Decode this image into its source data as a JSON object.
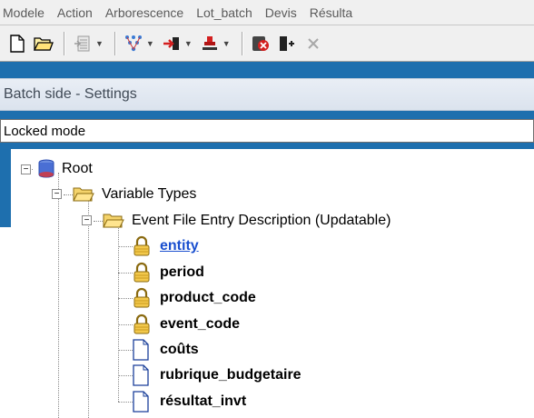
{
  "menu": [
    "Modele",
    "Action",
    "Arborescence",
    "Lot_batch",
    "Devis",
    "Résulta"
  ],
  "toolbar": {
    "icons": [
      "new-file",
      "open-folder",
      "insert-row",
      "tree-expand",
      "export",
      "stamp",
      "stop",
      "exit",
      "close"
    ]
  },
  "panel": {
    "title": "Batch side - Settings"
  },
  "locked": {
    "text": "Locked mode"
  },
  "tree": {
    "root": "Root",
    "variable_types": "Variable Types",
    "event_file": "Event File Entry Description (Updatable)",
    "items": [
      {
        "label": "entity",
        "icon": "lock",
        "selected": true
      },
      {
        "label": "period",
        "icon": "lock"
      },
      {
        "label": "product_code",
        "icon": "lock"
      },
      {
        "label": "event_code",
        "icon": "lock"
      },
      {
        "label": "coûts",
        "icon": "document"
      },
      {
        "label": "rubrique_budgetaire",
        "icon": "document"
      },
      {
        "label": "résultat_invt",
        "icon": "document"
      }
    ]
  },
  "colors": {
    "background": "#1e6fae",
    "link": "#1a4fcf"
  }
}
